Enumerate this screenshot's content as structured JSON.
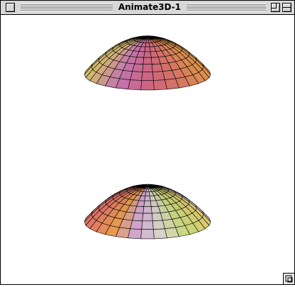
{
  "window": {
    "title": "Animate3D-1"
  },
  "colors": {
    "titlebar": "#d8d8d8",
    "content_bg": "#ffffff",
    "mesh_line": "#000000",
    "surface_palette": [
      "#e89a50",
      "#e07868",
      "#d86a8a",
      "#cc7ab8",
      "#e0c870",
      "#c8d878",
      "#d8d8c8",
      "#d0a8d8"
    ]
  },
  "icons": [
    "close-box-icon",
    "zoom-box-icon",
    "collapse-box-icon",
    "grow-box-icon"
  ],
  "surfaces": [
    {
      "kind": "upper-paraboloid-bowl"
    },
    {
      "kind": "lower-paraboloid-dome"
    }
  ]
}
